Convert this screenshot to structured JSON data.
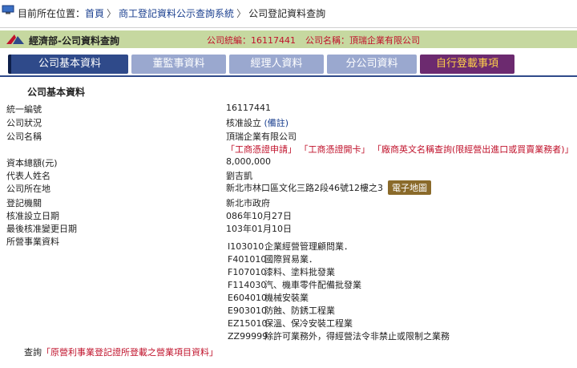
{
  "breadcrumb": {
    "prefix": "目前所在位置：",
    "items": [
      "首頁",
      "商工登記資料公示查詢系統",
      "公司登記資料查詢"
    ],
    "separator": "〉"
  },
  "header": {
    "title": "經濟部-公司資料查詢",
    "company_id_text": "公司統編：16117441",
    "company_name_text": "公司名稱：頂瑞企業有限公司"
  },
  "tabs": [
    {
      "label": "公司基本資料"
    },
    {
      "label": "董監事資料"
    },
    {
      "label": "經理人資料"
    },
    {
      "label": "分公司資料"
    },
    {
      "label": "自行登載事項"
    }
  ],
  "section_title": "公司基本資料",
  "fields": {
    "tax_id_label": "統一編號",
    "tax_id_value": "16117441",
    "status_label": "公司狀況",
    "status_value": "核准設立",
    "status_note": "(備註)",
    "name_label": "公司名稱",
    "name_value": "頂瑞企業有限公司",
    "name_links": [
      "「工商憑證申請」",
      "「工商憑證開卡」",
      "「廠商英文名稱查詢(限經營出進口或買賣業務者)」"
    ],
    "capital_label": "資本總額(元)",
    "capital_value": "8,000,000",
    "rep_label": "代表人姓名",
    "rep_value": "劉吉凱",
    "address_label": "公司所在地",
    "address_value": "新北市林口區文化三路2段46號12樓之3",
    "map_button": "電子地圖",
    "authority_label": "登記機關",
    "authority_value": "新北市政府",
    "approved_label": "核准設立日期",
    "approved_value": "086年10月27日",
    "changed_label": "最後核准變更日期",
    "changed_value": "103年01月10日",
    "business_label": "所營事業資料"
  },
  "business_items": [
    {
      "code": "I103010",
      "desc": "企業經營管理顧問業．"
    },
    {
      "code": "F401010",
      "desc": "國際貿易業．"
    },
    {
      "code": "F107010",
      "desc": "漆料、塗料批發業"
    },
    {
      "code": "F114030",
      "desc": "汽、機車零件配備批發業"
    },
    {
      "code": "E604010",
      "desc": "機械安裝業"
    },
    {
      "code": "E903010",
      "desc": "防蝕、防銹工程業"
    },
    {
      "code": "EZ15010",
      "desc": "保溫、保冷安裝工程業"
    },
    {
      "code": "ZZ99999",
      "desc": "除許可業務外，得經營法令非禁止或限制之業務"
    }
  ],
  "query": {
    "prefix": "查詢",
    "link": "「原營利事業登記證所登載之營業項目資料」"
  },
  "colors": {
    "header_bg": "#c6d8a0",
    "tab_active": "#2f4a8a",
    "tab_inactive": "#9aa8cf",
    "tab_special": "#6c2a6f",
    "accent_red": "#c0122b",
    "link_blue": "#1a3f8f"
  }
}
